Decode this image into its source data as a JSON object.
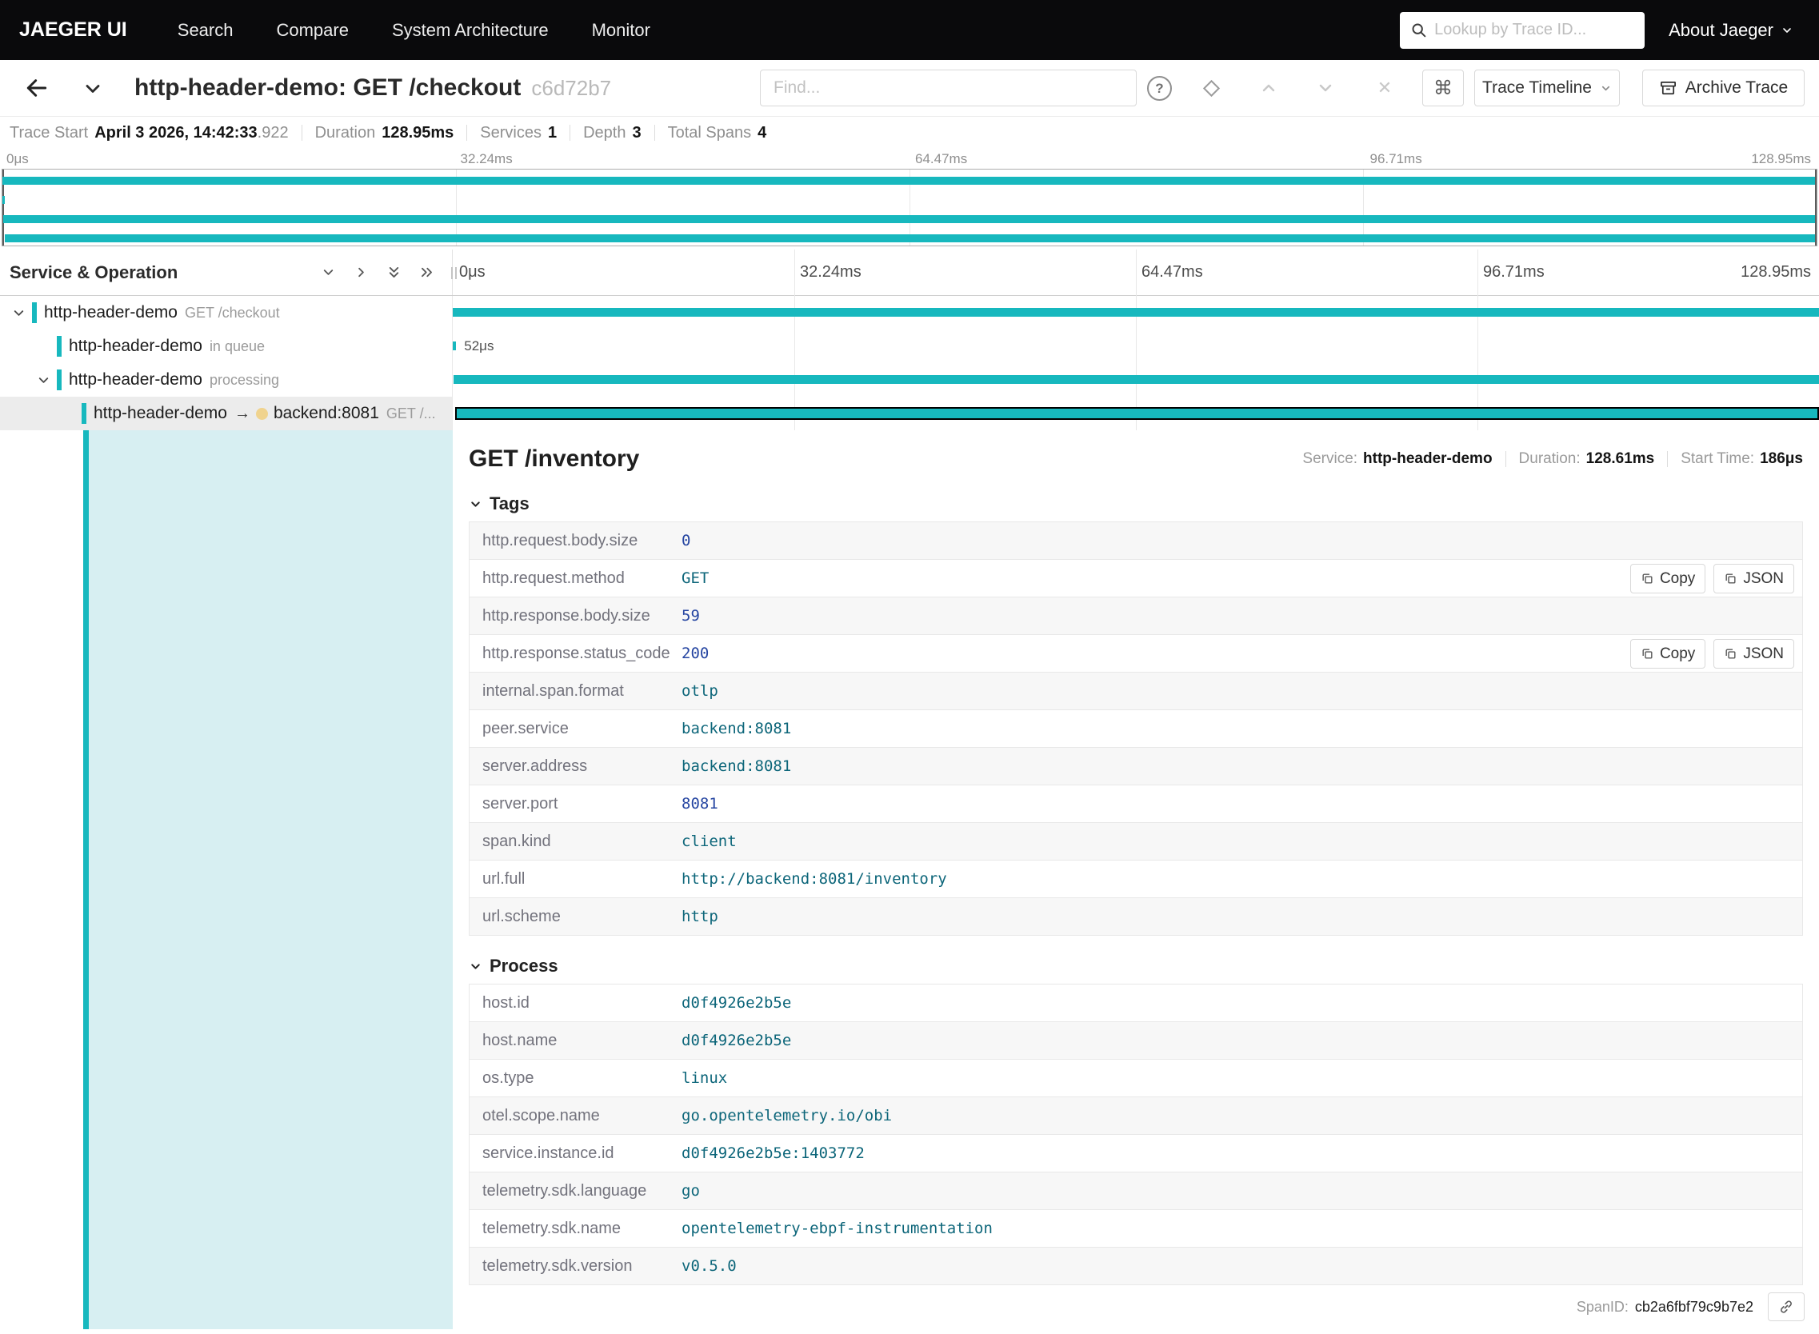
{
  "colors": {
    "accent": "#17b8be",
    "navbar_bg": "#0a0a0c",
    "selected_row_bg": "#ececec",
    "detail_tint": "#d7eff2",
    "remote_dot": "#f0d38e",
    "number_value": "#2545a1",
    "string_value": "#0d667a"
  },
  "icons": {
    "command": "⌘",
    "close": "✕",
    "arrow": "→",
    "help": "?"
  },
  "navbar": {
    "brand": "JAEGER UI",
    "items": [
      "Search",
      "Compare",
      "System Architecture",
      "Monitor"
    ],
    "lookup_placeholder": "Lookup by Trace ID...",
    "about_label": "About Jaeger"
  },
  "trace_header": {
    "title": "http-header-demo: GET /checkout",
    "trace_id": "c6d72b7",
    "find_placeholder": "Find...",
    "view_dropdown_label": "Trace Timeline",
    "archive_label": "Archive Trace"
  },
  "summary": {
    "trace_start_label": "Trace Start",
    "trace_start_value": "April 3 2026, 14:42:33",
    "trace_start_fraction": ".922",
    "duration_label": "Duration",
    "duration_value": "128.95ms",
    "services_label": "Services",
    "services_value": "1",
    "depth_label": "Depth",
    "depth_value": "3",
    "total_spans_label": "Total Spans",
    "total_spans_value": "4"
  },
  "timeline": {
    "left_header": "Service & Operation",
    "ticks": [
      "0μs",
      "32.24ms",
      "64.47ms",
      "96.71ms",
      "128.95ms"
    ],
    "rows": [
      {
        "service": "http-header-demo",
        "operation": "GET /checkout",
        "depth": 0,
        "expandable": true,
        "expanded": true,
        "bar": {
          "left": 0,
          "width": 100
        }
      },
      {
        "service": "http-header-demo",
        "operation": "in queue",
        "depth": 1,
        "expandable": false,
        "bar": {
          "left": 0,
          "width": 0.25
        },
        "duration_label": "52μs"
      },
      {
        "service": "http-header-demo",
        "operation": "processing",
        "depth": 1,
        "expandable": true,
        "expanded": true,
        "bar": {
          "left": 0.05,
          "width": 99.95
        }
      },
      {
        "service": "http-header-demo",
        "operation": "GET /...",
        "depth": 2,
        "expandable": false,
        "remote_service": "backend:8081",
        "selected": true,
        "bar": {
          "left": 0.15,
          "width": 99.85
        }
      }
    ]
  },
  "minimap": {
    "bars": [
      {
        "left": 0,
        "width": 100
      },
      {
        "left": 0,
        "width": 0.15
      },
      {
        "left": 0.05,
        "width": 99.95
      },
      {
        "left": 0.15,
        "width": 99.85
      }
    ]
  },
  "detail": {
    "title": "GET /inventory",
    "service_label": "Service:",
    "service_value": "http-header-demo",
    "duration_label": "Duration:",
    "duration_value": "128.61ms",
    "start_label": "Start Time:",
    "start_value": "186μs",
    "tags_label": "Tags",
    "process_label": "Process",
    "copy_label": "Copy",
    "json_label": "JSON",
    "spanid_label": "SpanID:",
    "spanid_value": "cb2a6fbf79c9b7e2",
    "tags": [
      {
        "key": "http.request.body.size",
        "value": "0",
        "type": "number"
      },
      {
        "key": "http.request.method",
        "value": "GET",
        "type": "string",
        "actions": true
      },
      {
        "key": "http.response.body.size",
        "value": "59",
        "type": "number"
      },
      {
        "key": "http.response.status_code",
        "value": "200",
        "type": "number",
        "actions": true
      },
      {
        "key": "internal.span.format",
        "value": "otlp",
        "type": "string"
      },
      {
        "key": "peer.service",
        "value": "backend:8081",
        "type": "string"
      },
      {
        "key": "server.address",
        "value": "backend:8081",
        "type": "string"
      },
      {
        "key": "server.port",
        "value": "8081",
        "type": "number"
      },
      {
        "key": "span.kind",
        "value": "client",
        "type": "string"
      },
      {
        "key": "url.full",
        "value": "http://backend:8081/inventory",
        "type": "string"
      },
      {
        "key": "url.scheme",
        "value": "http",
        "type": "string"
      }
    ],
    "process": [
      {
        "key": "host.id",
        "value": "d0f4926e2b5e",
        "type": "string"
      },
      {
        "key": "host.name",
        "value": "d0f4926e2b5e",
        "type": "string"
      },
      {
        "key": "os.type",
        "value": "linux",
        "type": "string"
      },
      {
        "key": "otel.scope.name",
        "value": "go.opentelemetry.io/obi",
        "type": "string"
      },
      {
        "key": "service.instance.id",
        "value": "d0f4926e2b5e:1403772",
        "type": "string"
      },
      {
        "key": "telemetry.sdk.language",
        "value": "go",
        "type": "string"
      },
      {
        "key": "telemetry.sdk.name",
        "value": "opentelemetry-ebpf-instrumentation",
        "type": "string"
      },
      {
        "key": "telemetry.sdk.version",
        "value": "v0.5.0",
        "type": "string"
      }
    ]
  }
}
